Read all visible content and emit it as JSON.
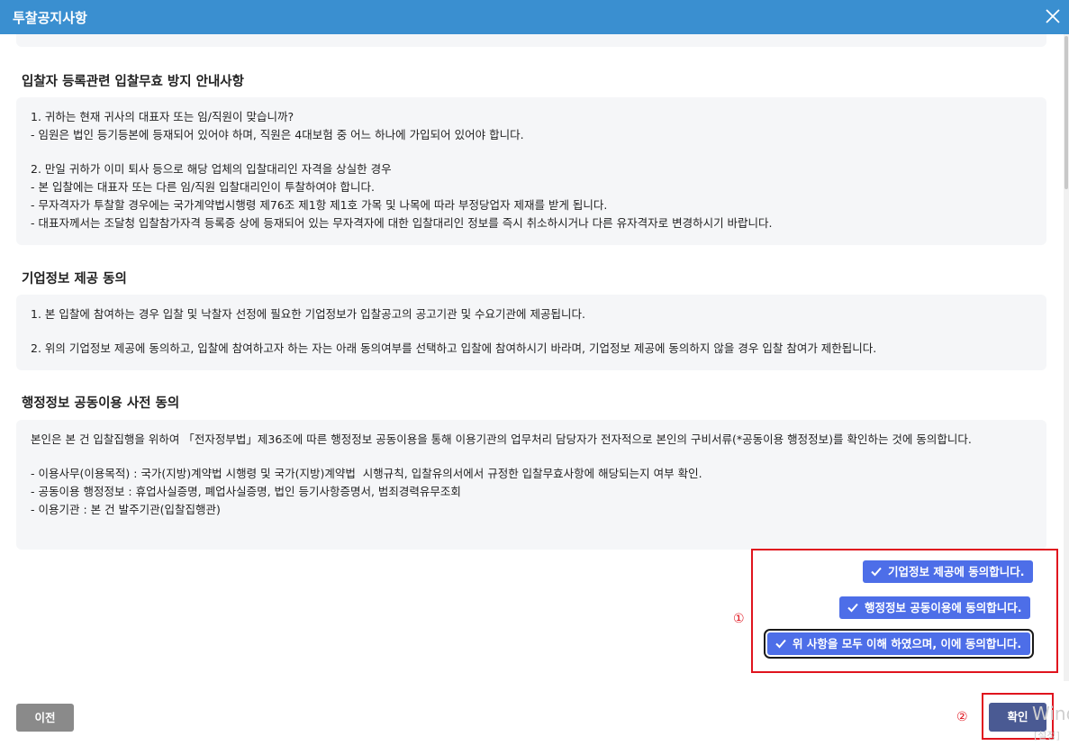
{
  "dialog": {
    "title": "투찰공지사항"
  },
  "sections": {
    "registration": {
      "heading": "입찰자 등록관련 입찰무효 방지 안내사항",
      "lines": [
        "1. 귀하는 현재 귀사의 대표자 또는 임/직원이 맞습니까?",
        "- 임원은 법인 등기등본에 등재되어 있어야 하며, 직원은 4대보험 중 어느 하나에 가입되어 있어야 합니다.",
        "2. 만일 귀하가 이미 퇴사 등으로 해당 업체의 입찰대리인 자격을 상실한 경우",
        "- 본 입찰에는 대표자 또는 다른 임/직원 입찰대리인이 투찰하여야 합니다.",
        "- 무자격자가 투찰할 경우에는 국가계약법시행령 제76조 제1항 제1호 가목 및 나목에 따라 부정당업자 제재를 받게 됩니다.",
        "- 대표자께서는 조달청 입찰참가자격 등록증 상에 등재되어 있는 무자격자에 대한 입찰대리인 정보를 즉시 취소하시거나 다른 유자격자로 변경하시기 바랍니다."
      ]
    },
    "company_info": {
      "heading": "기업정보 제공 동의",
      "lines": [
        "1. 본 입찰에 참여하는 경우 입찰 및 낙찰자 선정에 필요한 기업정보가 입찰공고의 공고기관 및 수요기관에 제공됩니다.",
        "2. 위의 기업정보 제공에 동의하고, 입찰에 참여하고자 하는 자는 아래 동의여부를 선택하고 입찰에 참여하시기 바라며, 기업정보 제공에 동의하지 않을 경우 입찰 참여가 제한됩니다."
      ]
    },
    "admin_info": {
      "heading": "행정정보 공동이용 사전 동의",
      "intro": "본인은 본 건 입찰집행을 위하여 「전자정부법」제36조에 따른 행정정보 공동이용을 통해 이용기관의 업무처리 담당자가 전자적으로 본인의 구비서류(*공동이용 행정정보)를 확인하는 것에 동의합니다.",
      "lines": [
        "- 이용사무(이용목적) : 국가(지방)계약법 시행령 및 국가(지방)계약법  시행규칙, 입찰유의서에서 규정한 입찰무효사항에 해당되는지 여부 확인.",
        "- 공동이용 행정정보 : 휴업사실증명, 폐업사실증명, 법인 등기사항증명서, 범죄경력유무조회",
        "- 이용기관 : 본 건 발주기관(입찰집행관)"
      ]
    }
  },
  "agreements": {
    "company_info_label": "기업정보 제공에 동의합니다.",
    "admin_info_label": "행정정보 공동이용에 동의합니다.",
    "all_label": "위 사항을 모두 이해 하였으며, 이에 동의합니다."
  },
  "markers": {
    "one": "①",
    "two": "②"
  },
  "footer": {
    "prev_label": "이전",
    "confirm_label": "확인"
  },
  "watermark": {
    "text": "Wind",
    "subtext": "[설정]"
  },
  "colors": {
    "titlebar": "#3a8fd0",
    "agree_button": "#4d6ee8",
    "confirm_button": "#4a5a93",
    "prev_button": "#8a8a8a",
    "highlight_box": "#e0141e",
    "content_box": "#f5f6f8"
  },
  "icons": {
    "close": "close-icon",
    "check": "check-icon"
  }
}
